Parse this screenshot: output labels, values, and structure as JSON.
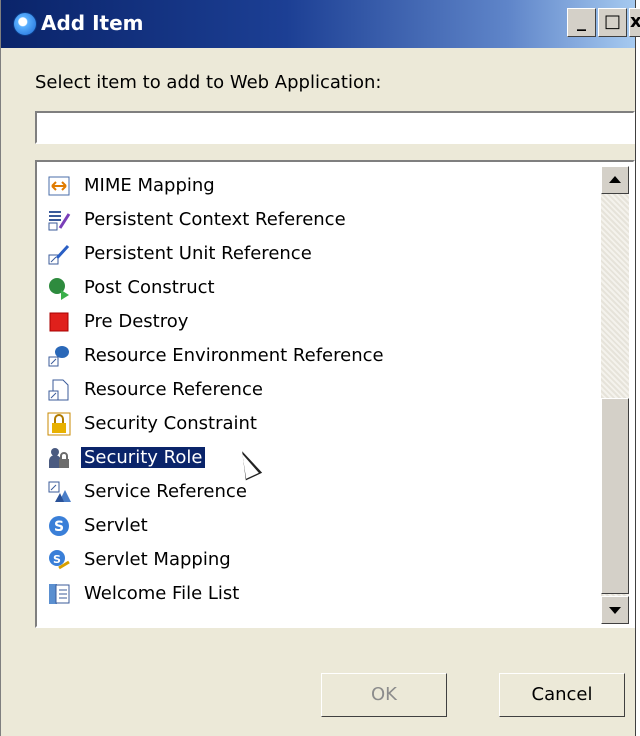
{
  "window": {
    "title": "Add Item",
    "controls": {
      "minimize": "_",
      "maximize": "□",
      "close": "x"
    }
  },
  "prompt_label": "Select item to add to Web Application:",
  "filter_input": {
    "value": "",
    "placeholder": ""
  },
  "items": [
    {
      "label": "MIME Mapping",
      "icon": "mime-mapping-icon",
      "selected": false
    },
    {
      "label": "Persistent Context Reference",
      "icon": "persistent-context-reference-icon",
      "selected": false
    },
    {
      "label": "Persistent Unit Reference",
      "icon": "persistent-unit-reference-icon",
      "selected": false
    },
    {
      "label": "Post Construct",
      "icon": "post-construct-icon",
      "selected": false
    },
    {
      "label": "Pre Destroy",
      "icon": "pre-destroy-icon",
      "selected": false
    },
    {
      "label": "Resource Environment Reference",
      "icon": "resource-environment-reference-icon",
      "selected": false
    },
    {
      "label": "Resource Reference",
      "icon": "resource-reference-icon",
      "selected": false
    },
    {
      "label": "Security Constraint",
      "icon": "security-constraint-icon",
      "selected": false
    },
    {
      "label": "Security Role",
      "icon": "security-role-icon",
      "selected": true
    },
    {
      "label": "Service Reference",
      "icon": "service-reference-icon",
      "selected": false
    },
    {
      "label": "Servlet",
      "icon": "servlet-icon",
      "selected": false
    },
    {
      "label": "Servlet Mapping",
      "icon": "servlet-mapping-icon",
      "selected": false
    },
    {
      "label": "Welcome File List",
      "icon": "welcome-file-list-icon",
      "selected": false
    }
  ],
  "buttons": {
    "ok": "OK",
    "cancel": "Cancel"
  },
  "colors": {
    "selection": "#0a246a",
    "titlebar": "#0a246a"
  }
}
